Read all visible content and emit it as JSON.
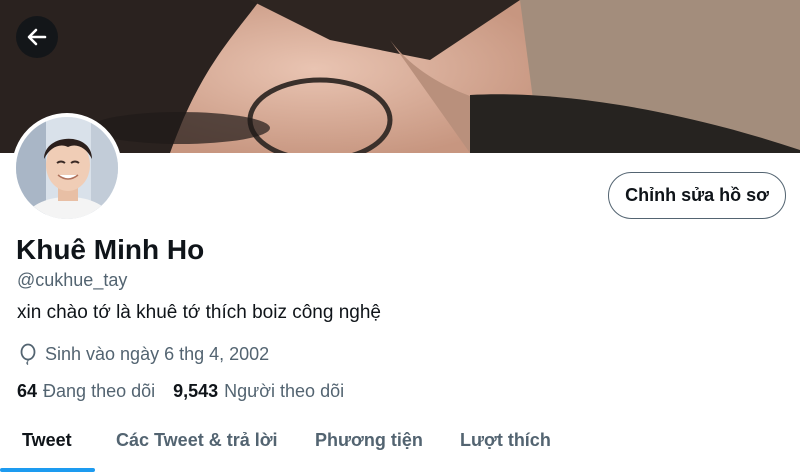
{
  "profile": {
    "display_name": "Khuê Minh Ho",
    "handle": "@cukhue_tay",
    "bio": "xin chào tớ là khuê tớ thích boiz công nghệ",
    "birthday": "Sinh vào ngày 6 thg 4, 2002",
    "following_count": "64",
    "following_label": "Đang theo dõi",
    "followers_count": "9,543",
    "followers_label": "Người theo dõi"
  },
  "actions": {
    "edit_profile_label": "Chỉnh sửa hồ sơ"
  },
  "tabs": [
    {
      "label": "Tweet",
      "active": true
    },
    {
      "label": "Các Tweet & trả lời",
      "active": false
    },
    {
      "label": "Phương tiện",
      "active": false
    },
    {
      "label": "Lượt thích",
      "active": false
    }
  ],
  "colors": {
    "accent": "#1d9bf0",
    "primary_text": "#0f1419",
    "secondary_text": "#536471"
  },
  "icons": {
    "back": "arrow-left-icon",
    "birthday": "balloon-icon"
  }
}
